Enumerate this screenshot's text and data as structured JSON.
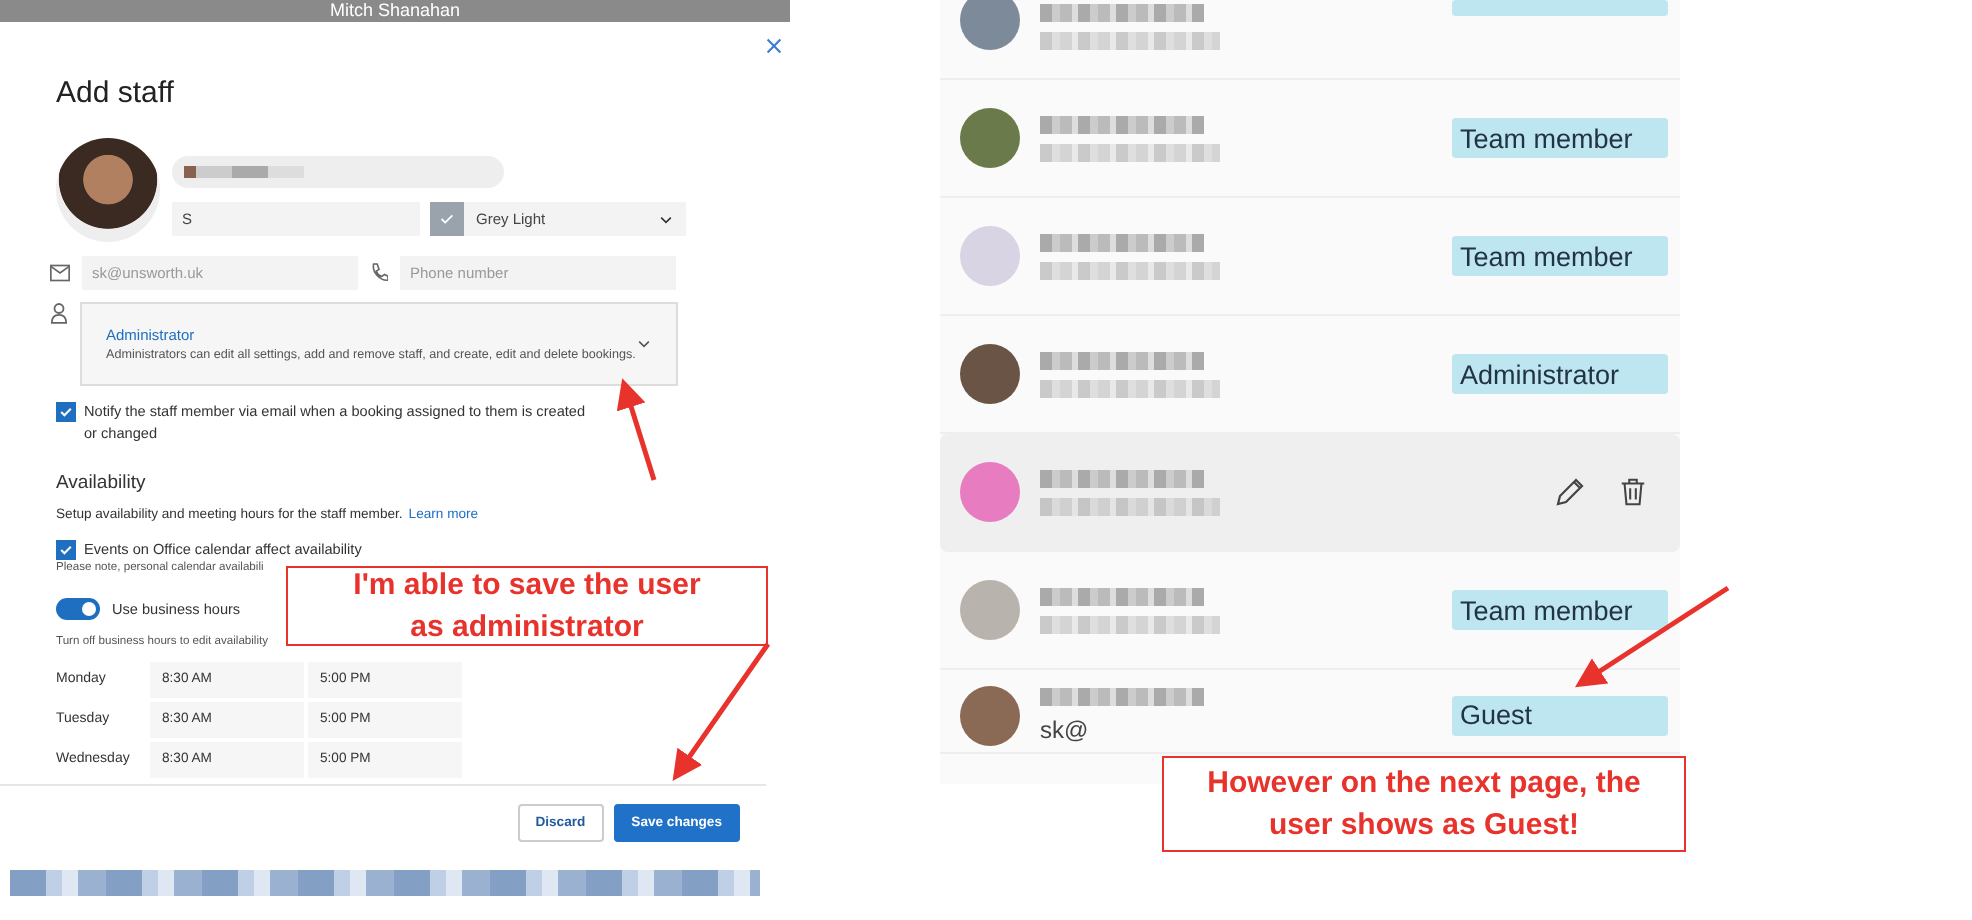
{
  "background_header": {
    "text": "Mitch Shanahan"
  },
  "dialog": {
    "title": "Add staff",
    "initials": "S",
    "color_option": {
      "label": "Grey Light",
      "color": "#9aa3ab"
    },
    "email": {
      "placeholder": "sk@unsworth.uk"
    },
    "phone": {
      "placeholder": "Phone number"
    },
    "role": {
      "title": "Administrator",
      "description": "Administrators can edit all settings, add and remove staff, and create, edit and delete bookings."
    },
    "notify": {
      "label": "Notify the staff member via email when a booking assigned to them is created or changed",
      "checked": true
    },
    "availability": {
      "heading": "Availability",
      "text": "Setup availability and meeting hours for the staff member.",
      "link": "Learn more"
    },
    "events": {
      "label": "Events on Office calendar affect availability",
      "checked": true,
      "note": "Please note, personal calendar availabili"
    },
    "business_hours": {
      "label": "Use business hours",
      "on": true,
      "hint": "Turn off business hours to edit availability"
    },
    "hours": [
      {
        "day": "Monday",
        "start": "8:30 AM",
        "end": "5:00 PM"
      },
      {
        "day": "Tuesday",
        "start": "8:30 AM",
        "end": "5:00 PM"
      },
      {
        "day": "Wednesday",
        "start": "8:30 AM",
        "end": "5:00 PM"
      }
    ],
    "buttons": [
      {
        "label": "Discard",
        "kind": "secondary"
      },
      {
        "label": "Save changes",
        "kind": "primary"
      }
    ]
  },
  "staff_list": [
    {
      "hovered": false
    },
    {
      "role": "Team member",
      "hovered": false
    },
    {
      "role": "Team member",
      "hovered": false
    },
    {
      "role": "Administrator",
      "hovered": false
    },
    {
      "hovered": true
    },
    {
      "role": "Team member",
      "hovered": false
    },
    {
      "role": "Guest",
      "email": "sk@",
      "hovered": false
    }
  ],
  "annotations": [
    {
      "text": "I'm able to save the user as administrator"
    },
    {
      "text": "However on the next page, the user shows as Guest!"
    }
  ]
}
